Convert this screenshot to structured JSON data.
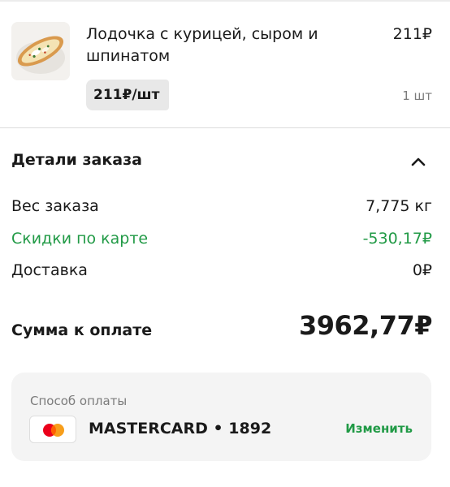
{
  "product": {
    "image_icon": "pizza-boat-image",
    "name": "Лодочка с курицей, сыром и шпинатом",
    "price": "211₽",
    "unit_price": "211₽/шт",
    "quantity": "1 шт"
  },
  "order_details": {
    "title": "Детали заказа",
    "toggle_icon": "chevron-up-icon",
    "weight_label": "Вес заказа",
    "weight_value": "7,775 кг",
    "discount_label": "Скидки по карте",
    "discount_value": "-530,17₽",
    "delivery_label": "Доставка",
    "delivery_value": "0₽",
    "total_label": "Сумма к оплате",
    "total_value": "3962,77₽"
  },
  "payment": {
    "title": "Способ оплаты",
    "card_icon": "mastercard-icon",
    "card_name": "MASTERCARD • 1892",
    "change_label": "Изменить"
  },
  "colors": {
    "accent_green": "#219a46",
    "muted_text": "#7b7b7b",
    "card_background": "#f4f4f4"
  }
}
